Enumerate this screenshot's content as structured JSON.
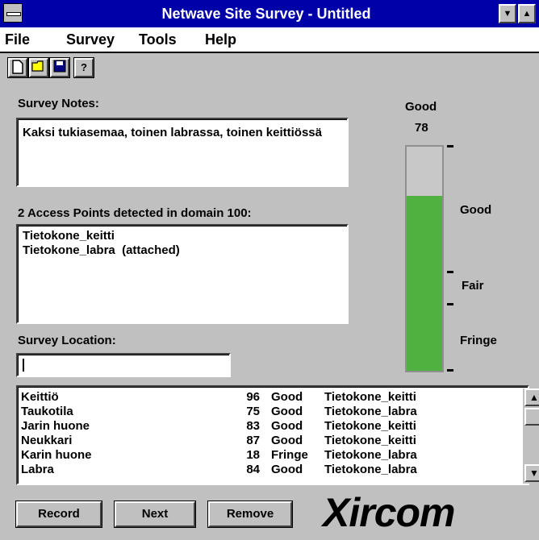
{
  "window": {
    "title": "Netwave Site Survey - Untitled"
  },
  "menu": [
    "File",
    "Survey",
    "Tools",
    "Help"
  ],
  "toolbar": {
    "help_glyph": "?"
  },
  "notes": {
    "label": "Survey Notes:",
    "text": "Kaksi tukiasemaa, toinen labrassa, toinen keittiössä"
  },
  "access_points": {
    "label": "2 Access Points detected in domain 100:",
    "items": [
      "Tietokone_keitti",
      "Tietokone_labra  (attached)"
    ]
  },
  "location": {
    "label": "Survey Location:",
    "value": ""
  },
  "signal": {
    "level_label": "Good",
    "value": "78",
    "fill_percent": 78,
    "scale": [
      "Good",
      "Fair",
      "Fringe"
    ]
  },
  "results": [
    {
      "location": "Keittiö",
      "value": "96",
      "quality": "Good",
      "ap": "Tietokone_keitti"
    },
    {
      "location": "Taukotila",
      "value": "75",
      "quality": "Good",
      "ap": "Tietokone_labra"
    },
    {
      "location": "Jarin huone",
      "value": "83",
      "quality": "Good",
      "ap": "Tietokone_keitti"
    },
    {
      "location": "Neukkari",
      "value": "87",
      "quality": "Good",
      "ap": "Tietokone_keitti"
    },
    {
      "location": "Karin huone",
      "value": "18",
      "quality": "Fringe",
      "ap": "Tietokone_labra"
    },
    {
      "location": "Labra",
      "value": "84",
      "quality": "Good",
      "ap": "Tietokone_labra"
    }
  ],
  "buttons": {
    "record": "Record",
    "next": "Next",
    "remove": "Remove"
  },
  "brand": {
    "logo": "Xircom"
  },
  "colors": {
    "titlebar": "#0000a8",
    "meter_fill": "#50b040"
  }
}
